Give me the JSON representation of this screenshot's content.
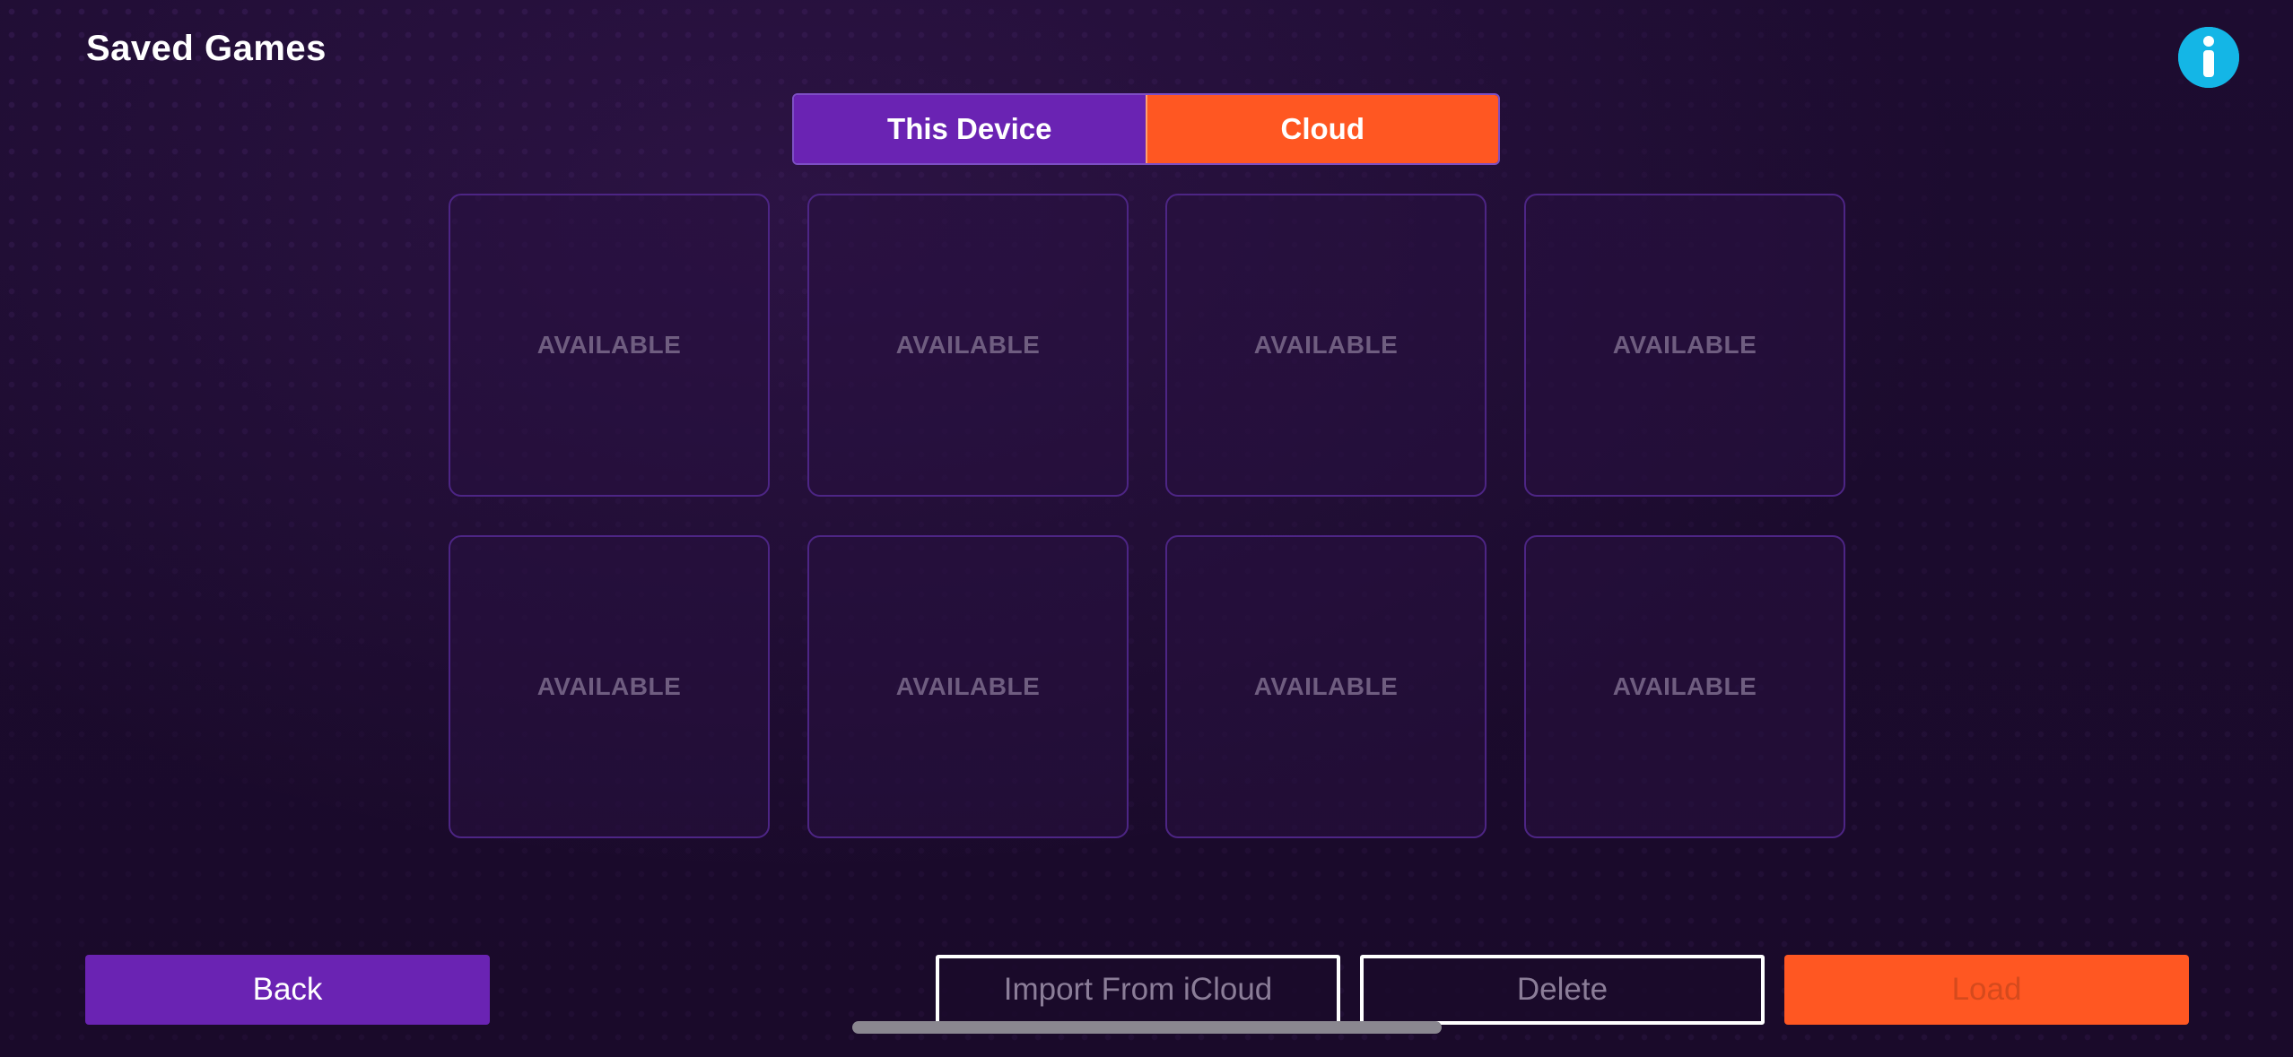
{
  "header": {
    "title": "Saved Games",
    "info_icon": "info-icon"
  },
  "tabs": {
    "device_label": "This Device",
    "cloud_label": "Cloud",
    "selected": "This Device"
  },
  "slots": [
    {
      "label": "AVAILABLE"
    },
    {
      "label": "AVAILABLE"
    },
    {
      "label": "AVAILABLE"
    },
    {
      "label": "AVAILABLE"
    },
    {
      "label": "AVAILABLE"
    },
    {
      "label": "AVAILABLE"
    },
    {
      "label": "AVAILABLE"
    },
    {
      "label": "AVAILABLE"
    }
  ],
  "footer": {
    "back_label": "Back",
    "import_label": "Import From iCloud",
    "delete_label": "Delete",
    "load_label": "Load"
  },
  "colors": {
    "background": "#1a0b2b",
    "purple_accent": "#6a23b3",
    "orange_accent": "#ff5722",
    "info_blue": "#14b6e6",
    "slot_border": "#4d2585"
  }
}
